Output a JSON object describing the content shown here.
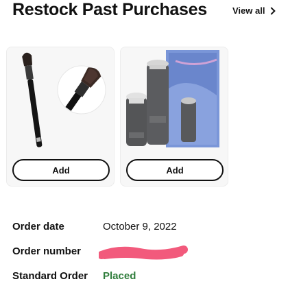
{
  "header": {
    "title": "Restock Past Purchases",
    "view_all_label": "View all",
    "view_all_icon": "chevron-right-icon"
  },
  "products": [
    {
      "image_description": "angled makeup brush",
      "add_label": "Add"
    },
    {
      "image_description": "living proof perfect hair day kit",
      "add_label": "Add"
    }
  ],
  "order": {
    "date_label": "Order date",
    "date_value": "October 9, 2022",
    "number_label": "Order number",
    "number_value_redacted": true,
    "type_label": "Standard Order",
    "status_value": "Placed",
    "status_color": "#2f7d3b"
  }
}
